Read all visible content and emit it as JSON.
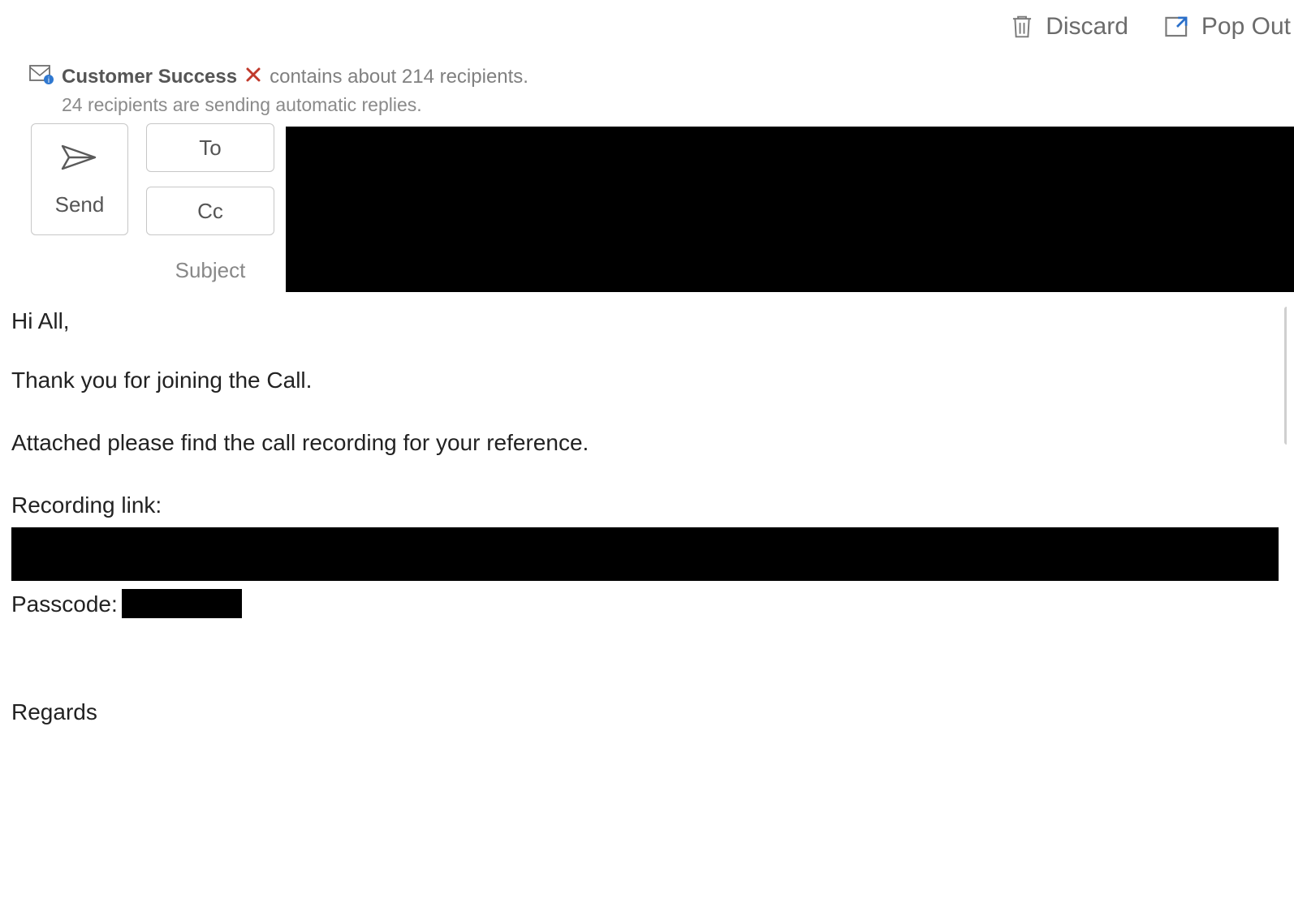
{
  "commands": {
    "discard": "Discard",
    "popout": "Pop Out"
  },
  "recipients": {
    "group_name": "Customer Success",
    "summary_suffix": "contains about 214 recipients.",
    "auto_reply_notice": "24 recipients are sending automatic replies."
  },
  "compose": {
    "send_label": "Send",
    "to_label": "To",
    "cc_label": "Cc",
    "subject_label": "Subject"
  },
  "body": {
    "greeting": "Hi All,",
    "line1": "Thank you for joining the Call.",
    "line2": "Attached please find the call recording for your reference.",
    "recording_label": "Recording link:",
    "passcode_label": "Passcode:",
    "signoff": "Regards"
  }
}
